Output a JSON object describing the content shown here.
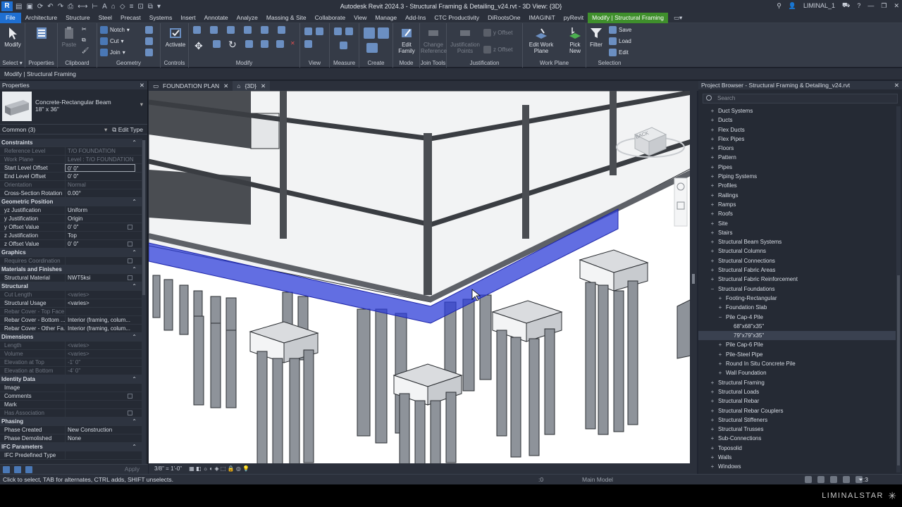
{
  "window": {
    "title": "Autodesk Revit 2024.3 - Structural Framing & Detailing_v24.rvt - 3D View: {3D}",
    "user": "LIMINAL_1",
    "app_icon": "R"
  },
  "ribbon_tabs": [
    "File",
    "Architecture",
    "Structure",
    "Steel",
    "Precast",
    "Systems",
    "Insert",
    "Annotate",
    "Analyze",
    "Massing & Site",
    "Collaborate",
    "View",
    "Manage",
    "Add-Ins",
    "CTC Productivity",
    "DiRootsOne",
    "IMAGINiT",
    "pyRevit",
    "Modify | Structural Framing"
  ],
  "ribbon": {
    "select": {
      "label": "Modify",
      "panel": "Select"
    },
    "properties": {
      "label": "Properties",
      "panel": "Properties"
    },
    "clipboard": {
      "paste": "Paste",
      "panel": "Clipboard"
    },
    "geometry": {
      "notch": "Notch",
      "cut": "Cut",
      "join": "Join",
      "panel": "Geometry"
    },
    "controls": {
      "activate": "Activate",
      "panel": "Controls"
    },
    "modify": {
      "panel": "Modify"
    },
    "view": {
      "panel": "View"
    },
    "measure": {
      "panel": "Measure"
    },
    "create": {
      "panel": "Create"
    },
    "mode": {
      "edit_family": "Edit Family",
      "panel": "Mode"
    },
    "join_tools": {
      "change_reference": "Change Reference",
      "panel": "Join Tools"
    },
    "justification": {
      "points": "Justification Points",
      "y_offset": "y Offset",
      "z_offset": "z Offset",
      "panel": "Justification"
    },
    "work_plane": {
      "edit": "Edit Work Plane",
      "pick_new": "Pick New",
      "panel": "Work Plane"
    },
    "selection": {
      "filter": "Filter",
      "save": "Save",
      "load": "Load",
      "edit": "Edit",
      "panel": "Selection"
    }
  },
  "options_bar": "Modify | Structural Framing",
  "properties": {
    "header": "Properties",
    "type_name": "Concrete-Rectangular Beam",
    "type_size": "18\" x 36\"",
    "filter": "Common (3)",
    "edit_type": "Edit Type",
    "apply": "Apply",
    "rows": [
      {
        "cat": "Constraints"
      },
      {
        "k": "Reference Level",
        "v": "T/O FOUNDATION",
        "ro": true
      },
      {
        "k": "Work Plane",
        "v": "Level : T/O FOUNDATION",
        "ro": true
      },
      {
        "k": "Start Level Offset",
        "v": "0' 0\"",
        "box": true
      },
      {
        "k": "End Level Offset",
        "v": "0' 0\""
      },
      {
        "k": "Orientation",
        "v": "Normal",
        "ro": true
      },
      {
        "k": "Cross-Section Rotation",
        "v": "0.00°"
      },
      {
        "cat": "Geometric Position"
      },
      {
        "k": "yz Justification",
        "v": "Uniform"
      },
      {
        "k": "y Justification",
        "v": "Origin"
      },
      {
        "k": "y Offset Value",
        "v": "0' 0\"",
        "cb": true
      },
      {
        "k": "z Justification",
        "v": "Top"
      },
      {
        "k": "z Offset Value",
        "v": "0' 0\"",
        "cb": true
      },
      {
        "cat": "Graphics"
      },
      {
        "k": "Requires Coordination",
        "v": "",
        "cb": true,
        "ro": true
      },
      {
        "cat": "Materials and Finishes"
      },
      {
        "k": "Structural Material",
        "v": "NWT5ksi",
        "cb": true
      },
      {
        "cat": "Structural"
      },
      {
        "k": "Cut Length",
        "v": "<varies>",
        "ro": true
      },
      {
        "k": "Structural Usage",
        "v": "<varies>"
      },
      {
        "k": "Rebar Cover - Top Face",
        "v": "",
        "ro": true
      },
      {
        "k": "Rebar Cover - Bottom ...",
        "v": "Interior (framing, colum..."
      },
      {
        "k": "Rebar Cover - Other Fa...",
        "v": "Interior (framing, colum..."
      },
      {
        "cat": "Dimensions"
      },
      {
        "k": "Length",
        "v": "<varies>",
        "ro": true
      },
      {
        "k": "Volume",
        "v": "<varies>",
        "ro": true
      },
      {
        "k": "Elevation at Top",
        "v": "-1' 0\"",
        "ro": true
      },
      {
        "k": "Elevation at Bottom",
        "v": "-4' 0\"",
        "ro": true
      },
      {
        "cat": "Identity Data"
      },
      {
        "k": "Image",
        "v": ""
      },
      {
        "k": "Comments",
        "v": "",
        "cb": true
      },
      {
        "k": "Mark",
        "v": ""
      },
      {
        "k": "Has Association",
        "v": "",
        "cb": true,
        "ro": true
      },
      {
        "cat": "Phasing"
      },
      {
        "k": "Phase Created",
        "v": "New Construction"
      },
      {
        "k": "Phase Demolished",
        "v": "None"
      },
      {
        "cat": "IFC Parameters"
      },
      {
        "k": "IFC Predefined Type",
        "v": ""
      }
    ]
  },
  "view_tabs": [
    {
      "label": "FOUNDATION PLAN",
      "active": false
    },
    {
      "label": "{3D}",
      "active": true
    }
  ],
  "view_bar": {
    "scale": "3/8\" = 1'-0\""
  },
  "viewcube": {
    "face": "BACK"
  },
  "browser": {
    "header": "Project Browser - Structural Framing & Detailing_v24.rvt",
    "search_placeholder": "Search",
    "items": [
      {
        "label": "Duct Systems",
        "lvl": 1,
        "pm": "+"
      },
      {
        "label": "Ducts",
        "lvl": 1,
        "pm": "+"
      },
      {
        "label": "Flex Ducts",
        "lvl": 1,
        "pm": "+"
      },
      {
        "label": "Flex Pipes",
        "lvl": 1,
        "pm": "+"
      },
      {
        "label": "Floors",
        "lvl": 1,
        "pm": "+"
      },
      {
        "label": "Pattern",
        "lvl": 1,
        "pm": "+"
      },
      {
        "label": "Pipes",
        "lvl": 1,
        "pm": "+"
      },
      {
        "label": "Piping Systems",
        "lvl": 1,
        "pm": "+"
      },
      {
        "label": "Profiles",
        "lvl": 1,
        "pm": "+"
      },
      {
        "label": "Railings",
        "lvl": 1,
        "pm": "+"
      },
      {
        "label": "Ramps",
        "lvl": 1,
        "pm": "+"
      },
      {
        "label": "Roofs",
        "lvl": 1,
        "pm": "+"
      },
      {
        "label": "Site",
        "lvl": 1,
        "pm": "+"
      },
      {
        "label": "Stairs",
        "lvl": 1,
        "pm": "+"
      },
      {
        "label": "Structural Beam Systems",
        "lvl": 1,
        "pm": "+"
      },
      {
        "label": "Structural Columns",
        "lvl": 1,
        "pm": "+"
      },
      {
        "label": "Structural Connections",
        "lvl": 1,
        "pm": "+"
      },
      {
        "label": "Structural Fabric Areas",
        "lvl": 1,
        "pm": "+"
      },
      {
        "label": "Structural Fabric Reinforcement",
        "lvl": 1,
        "pm": "+"
      },
      {
        "label": "Structural Foundations",
        "lvl": 1,
        "pm": "−"
      },
      {
        "label": "Footing-Rectangular",
        "lvl": 2,
        "pm": "+"
      },
      {
        "label": "Foundation Slab",
        "lvl": 2,
        "pm": "+"
      },
      {
        "label": "Pile Cap-4 Pile",
        "lvl": 2,
        "pm": "−"
      },
      {
        "label": "68\"x68\"x35\"",
        "lvl": 3,
        "pm": ""
      },
      {
        "label": "79\"x79\"x35\"",
        "lvl": 3,
        "pm": "",
        "sel": true
      },
      {
        "label": "Pile Cap-6 Pile",
        "lvl": 2,
        "pm": "+"
      },
      {
        "label": "Pile-Steel Pipe",
        "lvl": 2,
        "pm": "+"
      },
      {
        "label": "Round In Situ Concrete Pile",
        "lvl": 2,
        "pm": "+"
      },
      {
        "label": "Wall Foundation",
        "lvl": 2,
        "pm": "+"
      },
      {
        "label": "Structural Framing",
        "lvl": 1,
        "pm": "+"
      },
      {
        "label": "Structural Loads",
        "lvl": 1,
        "pm": "+"
      },
      {
        "label": "Structural Rebar",
        "lvl": 1,
        "pm": "+"
      },
      {
        "label": "Structural Rebar Couplers",
        "lvl": 1,
        "pm": "+"
      },
      {
        "label": "Structural Stiffeners",
        "lvl": 1,
        "pm": "+"
      },
      {
        "label": "Structural Trusses",
        "lvl": 1,
        "pm": "+"
      },
      {
        "label": "Sub-Connections",
        "lvl": 1,
        "pm": "+"
      },
      {
        "label": "Toposolid",
        "lvl": 1,
        "pm": "+"
      },
      {
        "label": "Walls",
        "lvl": 1,
        "pm": "+"
      },
      {
        "label": "Windows",
        "lvl": 1,
        "pm": "+"
      }
    ]
  },
  "status": {
    "message": "Click to select, TAB for alternates, CTRL adds, SHIFT unselects.",
    "worksets": ":0",
    "model": "Main Model",
    "filter_count": ":3"
  },
  "watermark": "LIMINALSTAR"
}
